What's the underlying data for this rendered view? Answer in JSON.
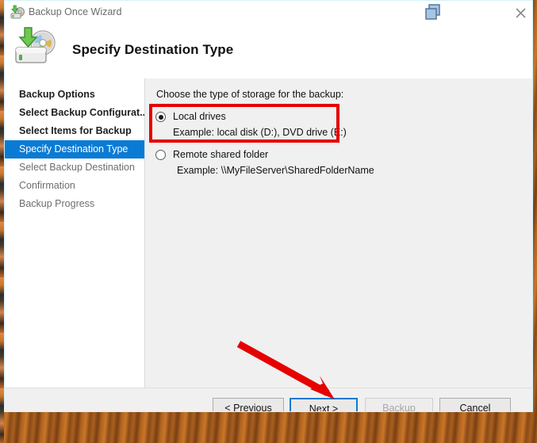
{
  "window": {
    "title": "Backup Once Wizard",
    "title_icon": "backup-disk-icon",
    "center_icon": "cascade-windows-icon",
    "close_icon": "close-icon"
  },
  "header": {
    "icon": "backup-destination-icon",
    "title": "Specify Destination Type"
  },
  "sidebar": {
    "items": [
      {
        "label": "Backup Options",
        "state": "done"
      },
      {
        "label": "Select Backup Configurat...",
        "state": "done"
      },
      {
        "label": "Select Items for Backup",
        "state": "done"
      },
      {
        "label": "Specify Destination Type",
        "state": "active"
      },
      {
        "label": "Select Backup Destination",
        "state": "future"
      },
      {
        "label": "Confirmation",
        "state": "future"
      },
      {
        "label": "Backup Progress",
        "state": "future"
      }
    ]
  },
  "content": {
    "prompt": "Choose the type of storage for the backup:",
    "options": [
      {
        "label": "Local drives",
        "example": "Example: local disk (D:), DVD drive (E:)",
        "selected": true
      },
      {
        "label": "Remote shared folder",
        "example": "Example: \\\\MyFileServer\\SharedFolderName",
        "selected": false
      }
    ]
  },
  "footer": {
    "buttons": [
      {
        "label": "< Previous",
        "state": "enabled"
      },
      {
        "label": "Next >",
        "state": "focused"
      },
      {
        "label": "Backup",
        "state": "disabled"
      },
      {
        "label": "Cancel",
        "state": "enabled"
      }
    ]
  },
  "annotations": {
    "highlight_box_color": "#e60000",
    "arrow_color": "#e60000",
    "accent_color": "#0a7bd4"
  }
}
